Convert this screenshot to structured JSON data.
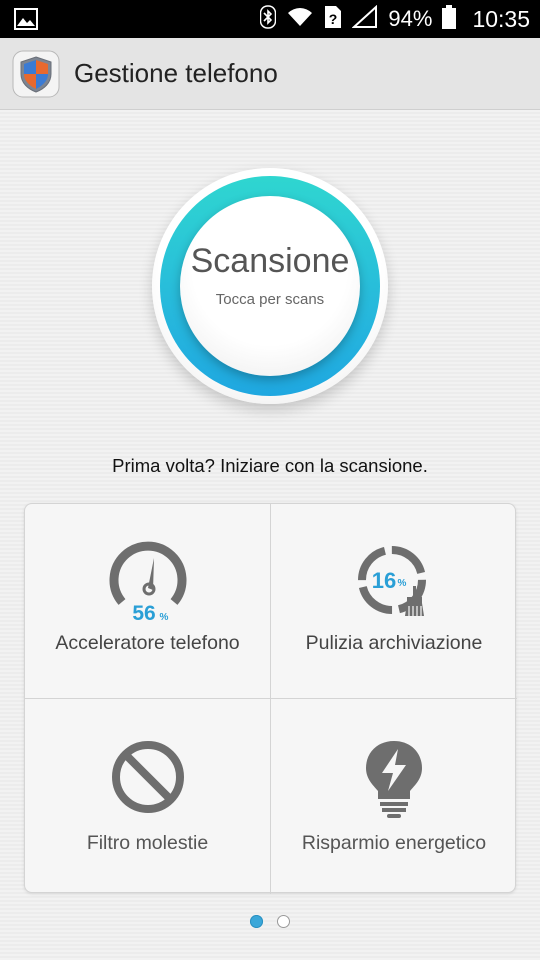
{
  "status_bar": {
    "battery_percent": "94%",
    "time": "10:35",
    "icons": [
      "image-icon",
      "bluetooth-icon",
      "wifi-icon",
      "sim-unknown-icon",
      "signal-icon",
      "battery-icon"
    ]
  },
  "action_bar": {
    "title": "Gestione telefono",
    "app_icon": "shield-icon"
  },
  "scan_button": {
    "title": "Scansione",
    "subtitle": "Tocca per scans"
  },
  "hint": "Prima volta? Iniziare con la scansione.",
  "tiles": [
    {
      "label": "Acceleratore telefono",
      "value": "56",
      "unit": "%",
      "icon": "speedometer-icon"
    },
    {
      "label": "Pulizia archiviazione",
      "value": "16",
      "unit": "%",
      "icon": "storage-cleanup-icon"
    },
    {
      "label": "Filtro molestie",
      "icon": "block-icon"
    },
    {
      "label": "Risparmio energetico",
      "icon": "power-saving-bulb-icon"
    }
  ],
  "pager": {
    "pages": 2,
    "current": 1
  },
  "colors": {
    "accent": "#2a9fd6",
    "ring_top": "#2fd6d0",
    "ring_bottom": "#1fa7e0",
    "icon_gray": "#6e6e6e"
  }
}
